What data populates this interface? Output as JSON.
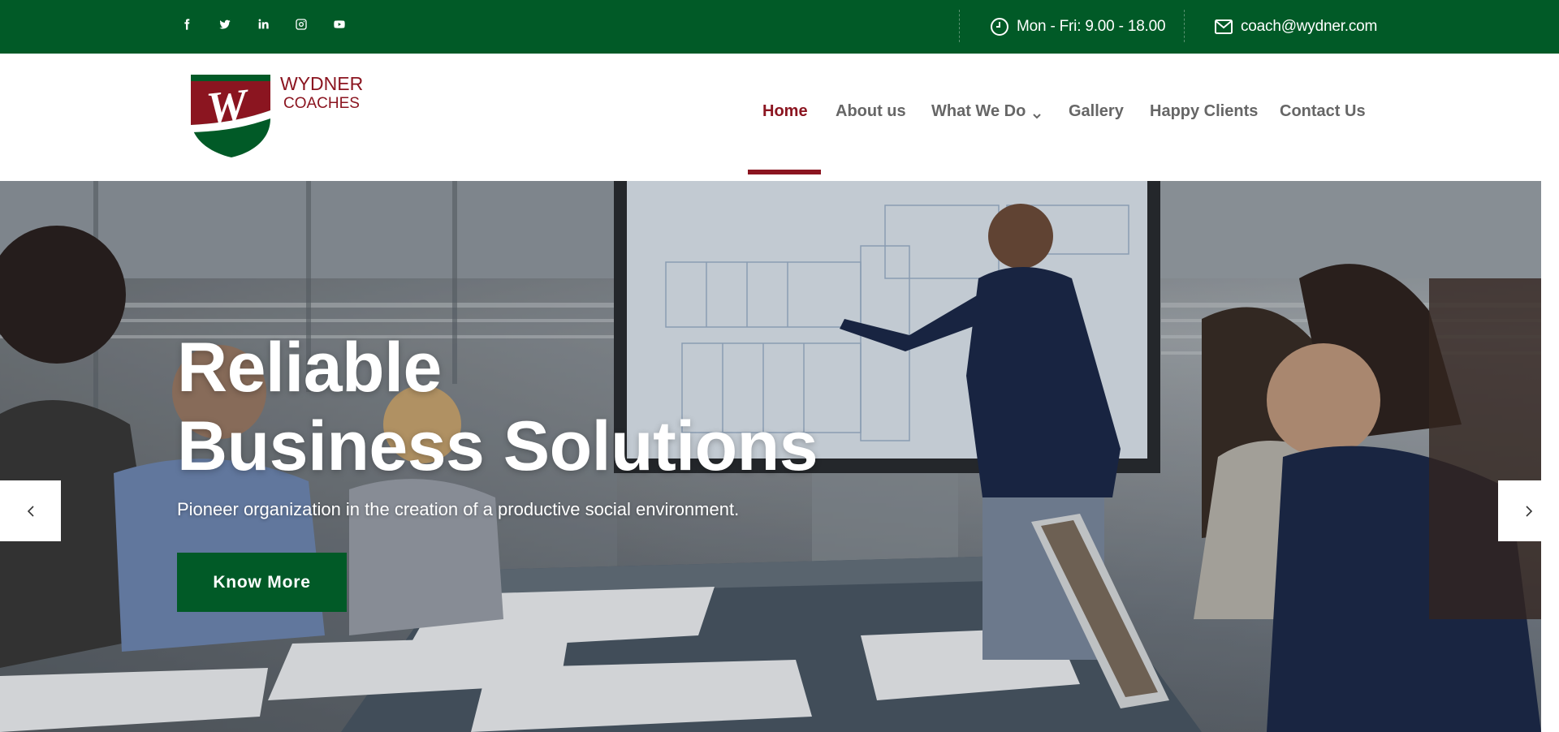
{
  "topbar": {
    "social": [
      {
        "name": "facebook-icon"
      },
      {
        "name": "twitter-icon"
      },
      {
        "name": "linkedin-icon"
      },
      {
        "name": "instagram-icon"
      },
      {
        "name": "youtube-icon"
      }
    ],
    "hours": "Mon - Fri: 9.00 - 18.00",
    "email": "coach@wydner.com"
  },
  "logo": {
    "line1": "WYDNER",
    "line2": "COACHES",
    "mark": "W"
  },
  "nav": {
    "items": [
      {
        "label": "Home",
        "active": true
      },
      {
        "label": "About us"
      },
      {
        "label": "What We Do",
        "dropdown": true
      },
      {
        "label": "Gallery"
      },
      {
        "label": "Happy Clients"
      },
      {
        "label": "Contact Us"
      }
    ]
  },
  "hero": {
    "title_line1": "Reliable",
    "title_line2": "Business Solutions",
    "subtitle": "Pioneer organization in the creation of a productive social environment.",
    "button": "Know More"
  },
  "colors": {
    "brand_green": "#015a27",
    "brand_red": "#8b1520",
    "nav_text": "#666666"
  }
}
